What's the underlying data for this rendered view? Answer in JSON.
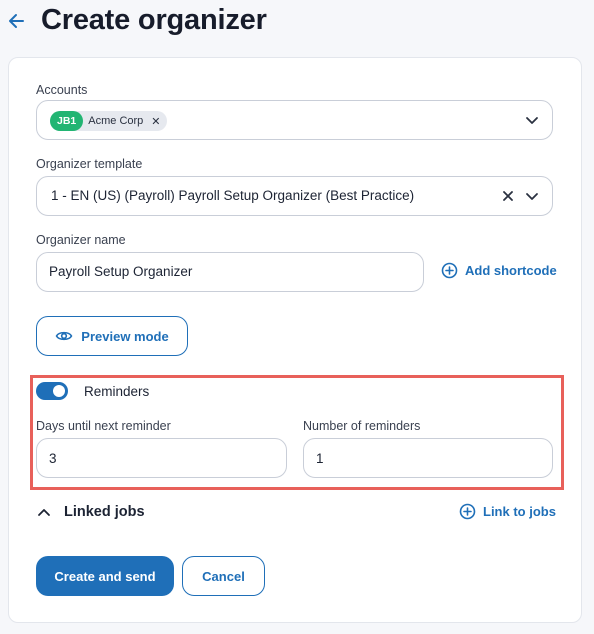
{
  "header": {
    "title": "Create organizer",
    "back_icon": "arrow-left-icon"
  },
  "form": {
    "accounts": {
      "label": "Accounts",
      "chips": [
        {
          "badge": "JB1",
          "name": "Acme Corp",
          "badge_color": "#22b573"
        }
      ]
    },
    "template": {
      "label": "Organizer template",
      "value": "1 - EN (US) (Payroll) Payroll Setup Organizer (Best Practice)"
    },
    "organizer_name": {
      "label": "Organizer name",
      "value": "Payroll Setup Organizer",
      "add_shortcode": "Add shortcode"
    },
    "preview_button": "Preview mode",
    "reminders": {
      "enabled": true,
      "label": "Reminders",
      "days_label": "Days until next reminder",
      "days_value": "3",
      "count_label": "Number of reminders",
      "count_value": "1"
    },
    "linked_jobs": {
      "title": "Linked jobs",
      "link_label": "Link to jobs"
    },
    "actions": {
      "submit": "Create and send",
      "cancel": "Cancel"
    }
  },
  "colors": {
    "accent": "#1f6fb8",
    "highlight": "#e8605a",
    "chip_badge": "#22b573"
  }
}
